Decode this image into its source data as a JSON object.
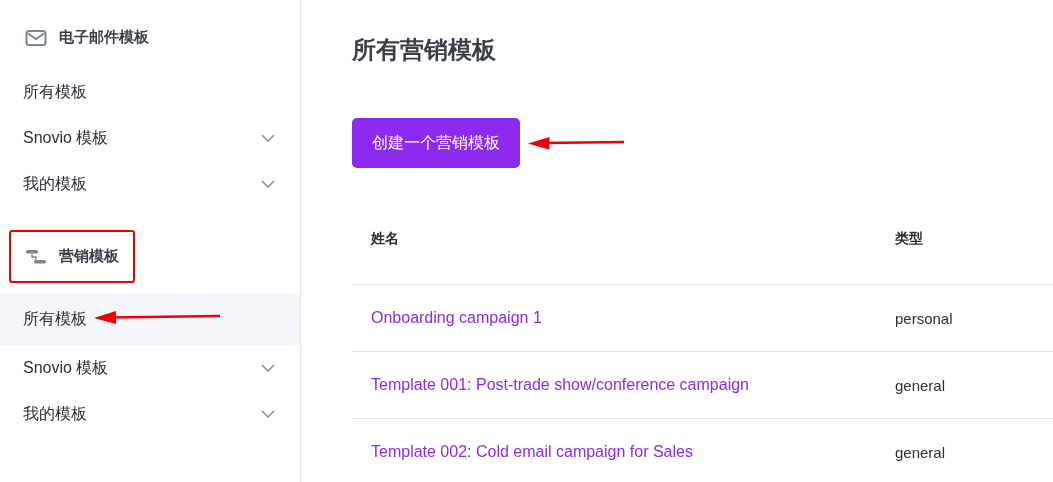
{
  "sidebar": {
    "sections": [
      {
        "kind": "email",
        "title": "电子邮件模板",
        "highlighted": false,
        "items": [
          {
            "label": "所有模板",
            "kind": "link",
            "selected": false,
            "arrow": false
          },
          {
            "label": "Snovio 模板",
            "kind": "expandable",
            "selected": false,
            "arrow": false
          },
          {
            "label": "我的模板",
            "kind": "expandable",
            "selected": false,
            "arrow": false
          }
        ]
      },
      {
        "kind": "marketing",
        "title": "营销模板",
        "highlighted": true,
        "items": [
          {
            "label": "所有模板",
            "kind": "link",
            "selected": true,
            "arrow": true
          },
          {
            "label": "Snovio 模板",
            "kind": "expandable",
            "selected": false,
            "arrow": false
          },
          {
            "label": "我的模板",
            "kind": "expandable",
            "selected": false,
            "arrow": false
          }
        ]
      }
    ]
  },
  "main": {
    "title": "所有营销模板",
    "create_button": {
      "label": "创建一个营销模板",
      "arrow": true
    },
    "table": {
      "columns": [
        "姓名",
        "类型"
      ],
      "rows": [
        [
          "Onboarding campaign 1",
          "personal"
        ],
        [
          "Template 001: Post-trade show/conference campaign",
          "general"
        ],
        [
          "Template 002: Cold email campaign for Sales",
          "general"
        ]
      ]
    }
  }
}
